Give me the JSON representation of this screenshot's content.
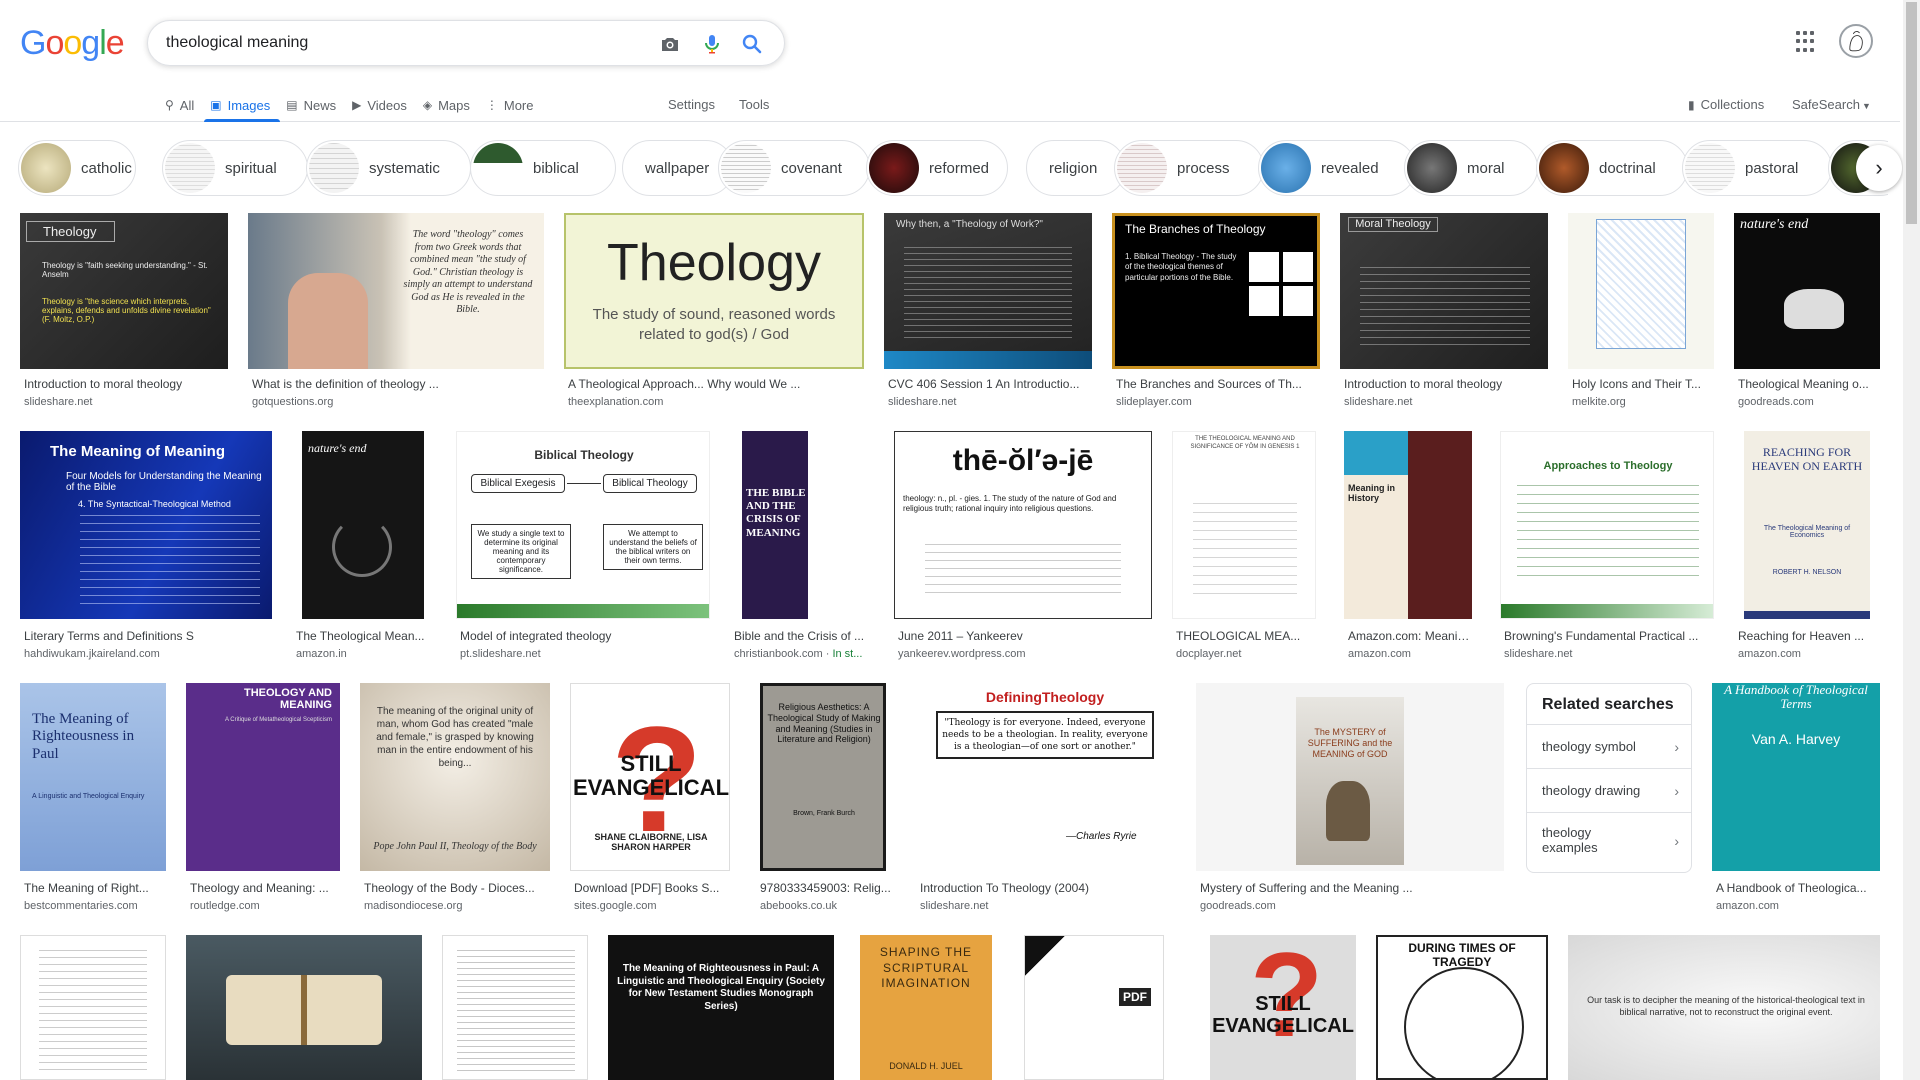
{
  "search": {
    "query": "theological meaning"
  },
  "logo": {
    "letters": [
      "G",
      "o",
      "o",
      "g",
      "l",
      "e"
    ],
    "colors": [
      "#4285F4",
      "#EA4335",
      "#FBBC05",
      "#4285F4",
      "#34A853",
      "#EA4335"
    ]
  },
  "tabs": [
    {
      "label": "All",
      "icon": "search-icon"
    },
    {
      "label": "Images",
      "icon": "image-icon",
      "active": true
    },
    {
      "label": "News",
      "icon": "news-icon"
    },
    {
      "label": "Videos",
      "icon": "video-icon"
    },
    {
      "label": "Maps",
      "icon": "map-icon"
    },
    {
      "label": "More",
      "icon": "more-vert-icon"
    }
  ],
  "toolbar": {
    "settings": "Settings",
    "tools": "Tools",
    "collections": "Collections",
    "safesearch": "SafeSearch"
  },
  "chips": [
    "catholic",
    "spiritual",
    "systematic",
    "biblical",
    "wallpaper",
    "covenant",
    "reformed",
    "religion",
    "process",
    "revealed",
    "moral",
    "doctrinal",
    "pastoral"
  ],
  "results": [
    {
      "caption": "Introduction to moral theology",
      "source": "slideshare.net"
    },
    {
      "caption": "What is the definition of theology ...",
      "source": "gotquestions.org"
    },
    {
      "caption": "A Theological Approach... Why would We ...",
      "source": "theexplanation.com"
    },
    {
      "caption": "CVC 406 Session 1 An Introductio...",
      "source": "slideshare.net"
    },
    {
      "caption": "The Branches and Sources of Th...",
      "source": "slideplayer.com"
    },
    {
      "caption": "Introduction to moral theology",
      "source": "slideshare.net"
    },
    {
      "caption": "Holy Icons and Their T...",
      "source": "melkite.org"
    },
    {
      "caption": "Theological Meaning o...",
      "source": "goodreads.com"
    },
    {
      "caption": "Literary Terms and Definitions S",
      "source": "hahdiwukam.jkaireland.com"
    },
    {
      "caption": "The Theological Mean...",
      "source": "amazon.in"
    },
    {
      "caption": "Model of integrated theology",
      "source": "pt.slideshare.net"
    },
    {
      "caption": "Bible and the Crisis of ...",
      "source": "christianbook.com",
      "extra": "In st..."
    },
    {
      "caption": "June 2011 – Yankeerev",
      "source": "yankeerev.wordpress.com"
    },
    {
      "caption": "THEOLOGICAL MEA...",
      "source": "docplayer.net"
    },
    {
      "caption": "Amazon.com: Meanin...",
      "source": "amazon.com"
    },
    {
      "caption": "Browning's Fundamental Practical ...",
      "source": "slideshare.net"
    },
    {
      "caption": "Reaching for Heaven ...",
      "source": "amazon.com"
    },
    {
      "caption": "The Meaning of Right...",
      "source": "bestcommentaries.com"
    },
    {
      "caption": "Theology and Meaning: ...",
      "source": "routledge.com"
    },
    {
      "caption": "Theology of the Body - Dioces...",
      "source": "madisondiocese.org"
    },
    {
      "caption": "Download [PDF] Books S...",
      "source": "sites.google.com"
    },
    {
      "caption": "9780333459003: Relig...",
      "source": "abebooks.co.uk"
    },
    {
      "caption": "Introduction To Theology (2004)",
      "source": "slideshare.net"
    },
    {
      "caption": "Mystery of Suffering and the Meaning ...",
      "source": "goodreads.com"
    },
    {
      "caption": "A Handbook of Theologica...",
      "source": "amazon.com"
    }
  ],
  "imgtext": {
    "r1a": "Theology",
    "r1b": "Theology is \"faith seeking understanding.\" - St. Anselm",
    "r1c": "Theology is \"the science which interprets, explains, defends and unfolds divine revelation\" (F. Moltz, O.P.)",
    "r2a": "The word \"theology\" comes from two Greek words that combined mean \"the study of God.\" Christian theology is simply an attempt to understand God as He is revealed in the Bible.",
    "r3a": "Theology",
    "r3b": "The study of sound, reasoned words related to god(s) / God",
    "r4a": "Why then, a \"Theology of Work?\"",
    "r5a": "The Branches of Theology",
    "r5b": "1. Biblical Theology - The study of the theological themes of particular portions of the Bible.",
    "r6a": "Moral Theology",
    "r8a": "nature's end",
    "r9a": "The Meaning of Meaning",
    "r9b": "Four Models for Understanding the Meaning of the Bible",
    "r9c": "4. The Syntactical-Theological Method",
    "r10a": "nature's end",
    "r11a": "Biblical Theology",
    "r11b": "Biblical Exegesis",
    "r11c": "Biblical Theology",
    "r11d": "We study a single text to determine its original meaning and its contemporary significance.",
    "r11e": "We attempt to understand the beliefs of the biblical writers on their own terms.",
    "r12a": "THE BIBLE AND THE CRISIS OF MEANING",
    "r13a": "thē-ŏl′ə-jē",
    "r13b": "theology: n., pl. - gies. 1. The study of the nature of God and religious truth; rational inquiry into religious questions.",
    "r14a": "THE THEOLOGICAL MEANING AND SIGNIFICANCE OF YŌM IN GENESIS 1",
    "r15a": "Meaning in History",
    "r16a": "Approaches to Theology",
    "r17a": "REACHING FOR HEAVEN ON EARTH",
    "r17b": "The Theological Meaning of Economics",
    "r17c": "ROBERT H. NELSON",
    "r18a": "The Meaning of Righteousness in Paul",
    "r18b": "A Linguistic and Theological Enquiry",
    "r19a": "THEOLOGY AND MEANING",
    "r19b": "A Critique of Metatheological Scepticism",
    "r20a": "The meaning of the original unity of man, whom God has created \"male and female,\" is grasped by knowing man in the entire endowment of his being...",
    "r20b": "Pope John Paul II, Theology of the Body",
    "r21a": "STILL EVANGELICAL",
    "r21b": "SHANE CLAIBORNE, LISA SHARON HARPER",
    "r22a": "Religious Aesthetics: A Theological Study of Making and Meaning (Studies in Literature and Religion)",
    "r22b": "Brown, Frank Burch",
    "r23a": "DefiningTheology",
    "r23b": "\"Theology is for everyone. Indeed, everyone needs to be a theologian. In reality, everyone is a theologian—of one sort or another.\"",
    "r23c": "—Charles Ryrie",
    "r24a": "The MYSTERY of SUFFERING and the MEANING of GOD",
    "r25a": "A Handbook of Theological Terms",
    "r25b": "Van A. Harvey",
    "r29a": "The Meaning of Righteousness in Paul: A Linguistic and Theological Enquiry (Society for New Testament Studies Monograph Series)",
    "r30a": "SHAPING THE SCRIPTURAL IMAGINATION",
    "r30b": "DONALD H. JUEL",
    "r31a": "PDF",
    "r32a": "STILL EVANGELICAL",
    "r33a": "DURING TIMES OF TRAGEDY",
    "r34a": "Our task is to decipher the meaning of the historical-theological text in biblical narrative, not to reconstruct the original event."
  },
  "related": {
    "title": "Related searches",
    "items": [
      "theology symbol",
      "theology drawing",
      "theology examples"
    ]
  }
}
